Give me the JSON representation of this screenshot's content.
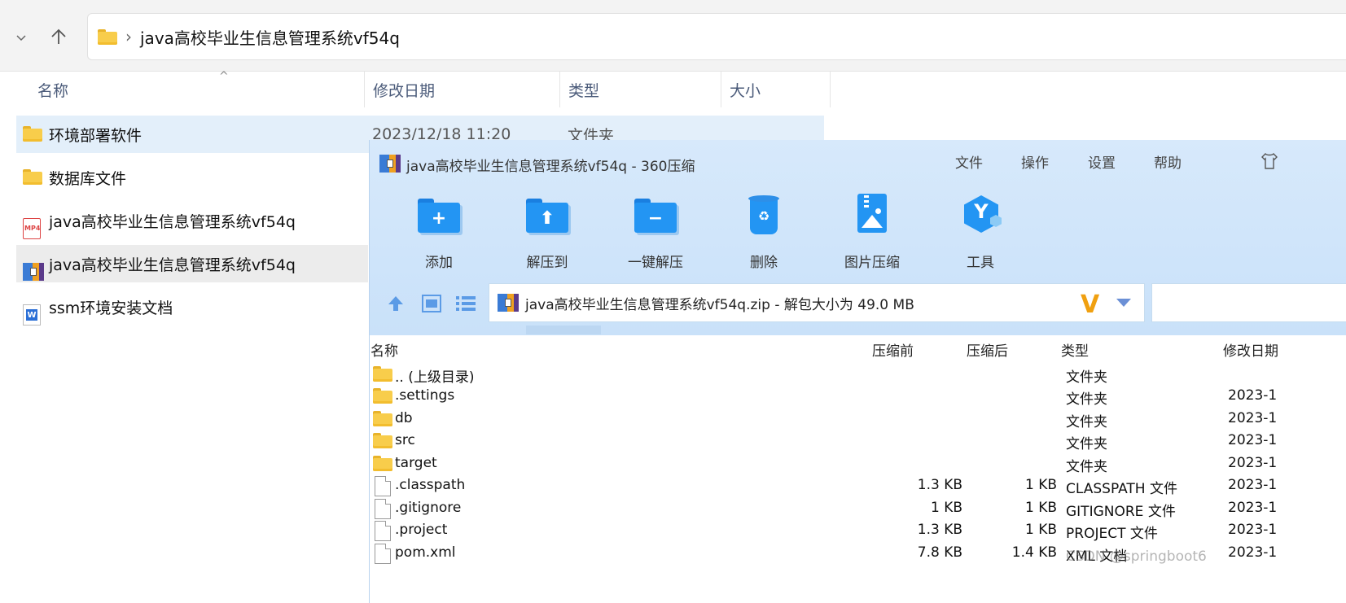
{
  "explorer": {
    "address": "java高校毕业生信息管理系统vf54q",
    "columns": {
      "name": "名称",
      "modified": "修改日期",
      "type": "类型",
      "size": "大小"
    },
    "items": [
      {
        "name": "环境部署软件",
        "date": "2023/12/18 11:20",
        "type": "文件夹",
        "icon": "folder-icon"
      },
      {
        "name": "数据库文件",
        "date": "",
        "type": "",
        "icon": "folder-icon"
      },
      {
        "name": "java高校毕业生信息管理系统vf54q",
        "date": "",
        "type": "",
        "icon": "mp4-file-icon"
      },
      {
        "name": "java高校毕业生信息管理系统vf54q",
        "date": "",
        "type": "",
        "icon": "zip-archive-icon"
      },
      {
        "name": "ssm环境安装文档",
        "date": "",
        "type": "",
        "icon": "word-doc-icon"
      }
    ]
  },
  "zipwin": {
    "title": "java高校毕业生信息管理系统vf54q - 360压缩",
    "menu": [
      "文件",
      "操作",
      "设置",
      "帮助"
    ],
    "toolbar": [
      "添加",
      "解压到",
      "一键解压",
      "删除",
      "图片压缩",
      "工具"
    ],
    "path": "java高校毕业生信息管理系统vf54q.zip - 解包大小为 49.0 MB",
    "v_logo": "V",
    "columns": {
      "name": "名称",
      "before": "压缩前",
      "after": "压缩后",
      "type": "类型",
      "modified": "修改日期"
    },
    "rows": [
      {
        "name": ".. (上级目录)",
        "before": "",
        "after": "",
        "type": "文件夹",
        "date": "",
        "icon": "folder-icon"
      },
      {
        "name": ".settings",
        "before": "",
        "after": "",
        "type": "文件夹",
        "date": "2023-1",
        "icon": "folder-icon"
      },
      {
        "name": "db",
        "before": "",
        "after": "",
        "type": "文件夹",
        "date": "2023-1",
        "icon": "folder-icon"
      },
      {
        "name": "src",
        "before": "",
        "after": "",
        "type": "文件夹",
        "date": "2023-1",
        "icon": "folder-icon"
      },
      {
        "name": "target",
        "before": "",
        "after": "",
        "type": "文件夹",
        "date": "2023-1",
        "icon": "folder-icon"
      },
      {
        "name": ".classpath",
        "before": "1.3 KB",
        "after": "1 KB",
        "type": "CLASSPATH 文件",
        "date": "2023-1",
        "icon": "file-icon"
      },
      {
        "name": ".gitignore",
        "before": "1 KB",
        "after": "1 KB",
        "type": "GITIGNORE 文件",
        "date": "2023-1",
        "icon": "file-icon"
      },
      {
        "name": ".project",
        "before": "1.3 KB",
        "after": "1 KB",
        "type": "PROJECT 文件",
        "date": "2023-1",
        "icon": "file-icon"
      },
      {
        "name": "pom.xml",
        "before": "7.8 KB",
        "after": "1.4 KB",
        "type": "XML 文档",
        "date": "2023-1",
        "icon": "file-icon"
      }
    ]
  },
  "watermark": "CSDN @springboot6",
  "colors": {
    "accent": "#2395f3",
    "selection": "#e3effa",
    "zip_header": "#c9e1f9",
    "folder": "#f8cd4b"
  }
}
